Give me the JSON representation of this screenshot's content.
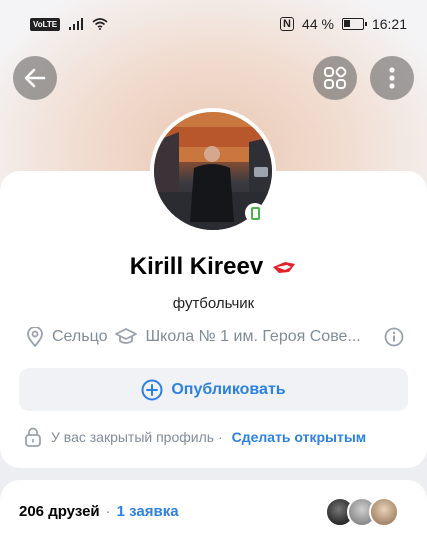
{
  "statusbar": {
    "volte": "VoLTE",
    "battery_percent": "44 %",
    "time": "16:21",
    "nfc": "N"
  },
  "profile": {
    "name": "Kirill Kireev",
    "status": "футбольчик",
    "city": "Сельцо",
    "school": "Школа № 1 им. Героя Сове...",
    "publish_label": "Опубликовать",
    "private_text": "У вас закрытый профиль ·",
    "make_open_label": "Сделать открытым"
  },
  "friends": {
    "count_label": "206 друзей",
    "separator": "·",
    "request_label": "1 заявка"
  },
  "colors": {
    "accent": "#2d81e0",
    "secondary_text": "#818c99",
    "online": "#4bb34b"
  },
  "icons": [
    "back-arrow-icon",
    "grid-icon",
    "more-vertical-icon",
    "location-pin-icon",
    "graduation-cap-icon",
    "info-icon",
    "plus-circle-icon",
    "lock-icon",
    "phone-online-icon",
    "spartak-badge-icon"
  ]
}
